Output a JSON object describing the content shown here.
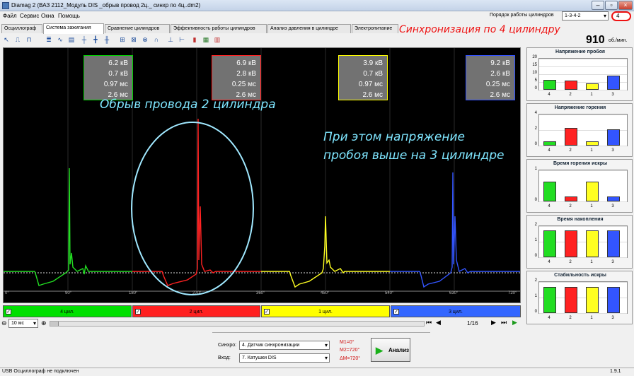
{
  "window": {
    "title": "Diamag 2 (ВАЗ 2112_Модуль DIS _обрыв провод 2ц._ синхр по 4ц..dm2)"
  },
  "menu": [
    "Файл",
    "Сервис",
    "Окна",
    "Помощь"
  ],
  "firing_order": {
    "label": "Порядок работы цилиндров",
    "value": "1-3-4-2",
    "cyl_value": "4"
  },
  "sync_note": "Синхронизация по 4 цилиндру",
  "tabs": [
    "Осциллограф",
    "Система зажигания",
    "Сравнение цилиндров",
    "Эффективность работы цилиндров",
    "Анализ давления в цилиндре",
    "Электропитание"
  ],
  "rpm": {
    "value": "910",
    "unit": "об./мин."
  },
  "readouts": [
    {
      "kv": "6.2 кВ",
      "burn_kv": "0.7 кВ",
      "burn_ms": "0.97 мс",
      "dwell_ms": "2.6 мс",
      "border": "#00d000"
    },
    {
      "kv": "6.9 кВ",
      "burn_kv": "2.8 кВ",
      "burn_ms": "0.25 мс",
      "dwell_ms": "2.6 мс",
      "border": "#ff2020"
    },
    {
      "kv": "3.9 кВ",
      "burn_kv": "0.7 кВ",
      "burn_ms": "0.97 мс",
      "dwell_ms": "2.6 мс",
      "border": "#ffff00"
    },
    {
      "kv": "9.2 кВ",
      "burn_kv": "2.6 кВ",
      "burn_ms": "0.25 мс",
      "dwell_ms": "2.6 мс",
      "border": "#3050ff"
    }
  ],
  "annotations": {
    "break": "Обрыв провода 2 цилиндра",
    "higher1": "При этом напряжение",
    "higher2": "пробоя выше на 3 цилиндре"
  },
  "x_ticks": [
    "0°",
    "90°",
    "180°",
    "270°",
    "360°",
    "450°",
    "540°",
    "630°",
    "720°"
  ],
  "cylinders": [
    {
      "label": "4 цил.",
      "color": "#00e000"
    },
    {
      "label": "2 цил.",
      "color": "#ff2020"
    },
    {
      "label": "1 цил.",
      "color": "#ffff00"
    },
    {
      "label": "3 цил.",
      "color": "#3366ff"
    }
  ],
  "nav": {
    "timebase": "10 мс",
    "page": "1/16"
  },
  "controls": {
    "sync_label": "Синхро:",
    "sync_value": "4. Датчик синхронизации",
    "input_label": "Вход:",
    "input_value": "7. Катушки DIS",
    "m1": "M1=0°",
    "m2": "M2=720°",
    "dm": "ΔM=720°",
    "analyze": "Анализ"
  },
  "status": {
    "left": "USB Осциллограф не подключен",
    "version": "1.9.1"
  },
  "side_x_labels": [
    "4",
    "2",
    "1",
    "3"
  ],
  "side_colors": [
    "#22dd22",
    "#ff2222",
    "#ffff22",
    "#3355ff"
  ],
  "side_panels": [
    {
      "title": "Напряжение пробоя",
      "yticks": [
        "20",
        "15",
        "10",
        "5",
        "0"
      ],
      "ymax": 20,
      "values": [
        6.2,
        6.0,
        3.9,
        9.2
      ]
    },
    {
      "title": "Напряжение горения",
      "yticks": [
        "4",
        "2",
        "0"
      ],
      "ymax": 5,
      "values": [
        0.7,
        2.8,
        0.7,
        2.6
      ]
    },
    {
      "title": "Время горения искры",
      "yticks": [
        "1",
        "0"
      ],
      "ymax": 1.5,
      "values": [
        0.97,
        0.25,
        0.97,
        0.25
      ]
    },
    {
      "title": "Время накопления",
      "yticks": [
        "2",
        "1",
        "0"
      ],
      "ymax": 3,
      "values": [
        2.6,
        2.6,
        2.6,
        2.6
      ]
    },
    {
      "title": "Стабильность искры",
      "yticks": [
        "2",
        "1",
        "0"
      ],
      "ymax": 2.4,
      "values": [
        2,
        2,
        2,
        2
      ]
    }
  ]
}
